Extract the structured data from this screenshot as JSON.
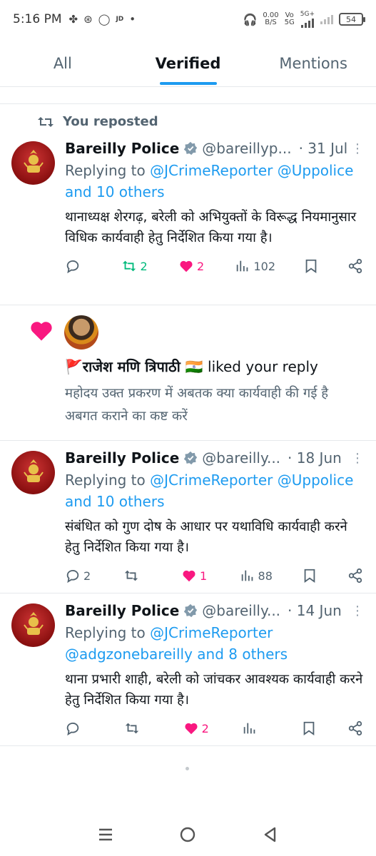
{
  "status_bar": {
    "time": "5:16 PM",
    "icons": [
      "grid-icon",
      "settings-wheel-icon",
      "whatsapp-icon",
      "jd-icon",
      "dot-icon"
    ],
    "jd_label": "JD",
    "net_speed_value": "0.00",
    "net_speed_unit": "B/S",
    "volte_label": "Vo",
    "volte_sub": "5G",
    "network_label": "5G+",
    "battery_level": "54"
  },
  "tabs": [
    {
      "label": "All"
    },
    {
      "label": "Verified"
    },
    {
      "label": "Mentions"
    }
  ],
  "posts": [
    {
      "repost_label": "You reposted",
      "name": "Bareilly Police",
      "handle": "@bareillyp...",
      "date": "· 31 Jul",
      "replying_prefix": "Replying to",
      "replying_mentions": "@JCrimeReporter @Uppolice",
      "replying_others": "and 10 others",
      "text": "थानाध्यक्ष शेरगढ़, बरेली को अभियुक्तों के विरूद्ध नियमानुसार विधिक कार्यवाही हेतु निर्देशित किया गया है।",
      "replies": "",
      "reposts": "2",
      "likes": "2",
      "views": "102"
    },
    {
      "name": "Bareilly Police",
      "handle": "@bareilly...",
      "date": "· 18 Jun",
      "replying_prefix": "Replying to",
      "replying_mentions": "@JCrimeReporter @Uppolice",
      "replying_others": "and 10 others",
      "text": "संबंधित को गुण दोष के आधार पर यथाविधि कार्यवाही करने हेतु निर्देशित किया गया है।",
      "replies": "2",
      "reposts": "",
      "likes": "1",
      "views": "88"
    },
    {
      "name": "Bareilly Police",
      "handle": "@bareilly...",
      "date": "· 14 Jun",
      "replying_prefix": "Replying to",
      "replying_mentions": "@JCrimeReporter",
      "replying_others": "@adgzonebareilly and 8 others",
      "text": "थाना प्रभारी शाही, बरेली को जांचकर आवश्यक कार्यवाही करने हेतु निर्देशित किया गया है।",
      "replies": "",
      "reposts": "",
      "likes": "2",
      "views": ""
    }
  ],
  "like_notification": {
    "liker_name": "🚩राजेश मणि त्रिपाठी 🇮🇳",
    "action": "liked your reply",
    "liked_text": "महोदय उक्त प्रकरण में अबतक क्या कार्यवाही की गई है अबगत कराने का कष्ट करें"
  },
  "colors": {
    "accent": "#1d9bf0",
    "like": "#f91880",
    "repost": "#00ba7c",
    "muted": "#536471"
  }
}
